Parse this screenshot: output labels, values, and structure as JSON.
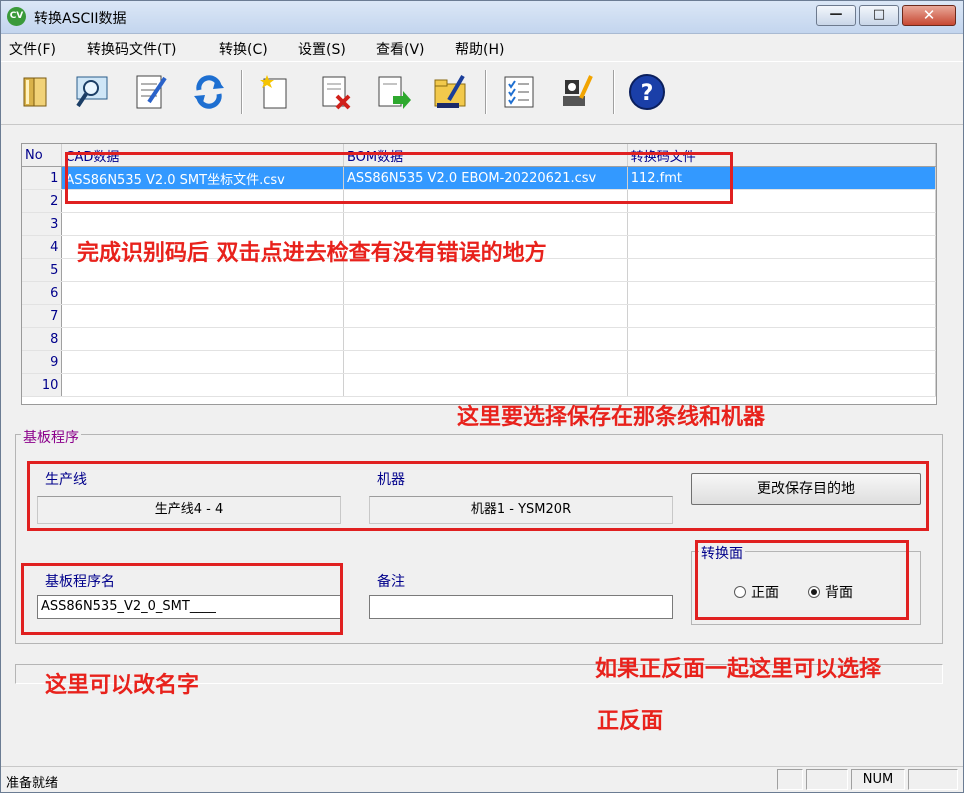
{
  "window": {
    "title": "转换ASCII数据",
    "app_icon": "CV",
    "min_glyph": "—",
    "max_glyph": "□",
    "close_glyph": "✕"
  },
  "menu": [
    "文件(F)",
    "转换码文件(T)",
    "转换(C)",
    "设置(S)",
    "查看(V)",
    "帮助(H)"
  ],
  "toolbar": [
    {
      "icon": "open-book-icon"
    },
    {
      "icon": "magnifier-screen-icon"
    },
    {
      "icon": "edit-notepad-icon"
    },
    {
      "icon": "refresh-arrows-icon"
    },
    {
      "icon": "new-file-icon"
    },
    {
      "icon": "delete-file-icon"
    },
    {
      "icon": "export-file-icon"
    },
    {
      "icon": "folder-pencil-icon"
    },
    {
      "icon": "checklist-icon"
    },
    {
      "icon": "tools-wizard-icon"
    },
    {
      "icon": "help-icon"
    }
  ],
  "grid": {
    "headers": [
      "No",
      "CAD数据",
      "BOM数据",
      "转换码文件"
    ],
    "rows": [
      {
        "no": "1",
        "cad": "ASS86N535 V2.0 SMT坐标文件.csv",
        "bom": "ASS86N535 V2.0 EBOM-20220621.csv",
        "fmt": "112.fmt"
      },
      {
        "no": "2",
        "cad": "",
        "bom": "",
        "fmt": ""
      },
      {
        "no": "3",
        "cad": "",
        "bom": "",
        "fmt": ""
      },
      {
        "no": "4",
        "cad": "",
        "bom": "",
        "fmt": ""
      },
      {
        "no": "5",
        "cad": "",
        "bom": "",
        "fmt": ""
      },
      {
        "no": "6",
        "cad": "",
        "bom": "",
        "fmt": ""
      },
      {
        "no": "7",
        "cad": "",
        "bom": "",
        "fmt": ""
      },
      {
        "no": "8",
        "cad": "",
        "bom": "",
        "fmt": ""
      },
      {
        "no": "9",
        "cad": "",
        "bom": "",
        "fmt": ""
      },
      {
        "no": "10",
        "cad": "",
        "bom": "",
        "fmt": ""
      }
    ]
  },
  "board": {
    "group_title": "基板程序",
    "line_label": "生产线",
    "line_value": "生产线4 - 4",
    "machine_label": "机器",
    "machine_value": "机器1 - YSM20R",
    "change_dest_button": "更改保存目的地",
    "program_label": "基板程序名",
    "program_value": "ASS86N535_V2_0_SMT____",
    "remark_label": "备注",
    "remark_value": "",
    "side_title": "转换面",
    "side_front": "正面",
    "side_back": "背面",
    "side_selected": "背面"
  },
  "status": {
    "text": "准备就绪",
    "num": "NUM"
  },
  "annotations": {
    "note_grid": "完成识别码后 双击点进去检查有没有错误的地方",
    "note_line": "这里要选择保存在那条线和机器",
    "note_name": "这里可以改名字",
    "note_side_1": "如果正反面一起这里可以选择",
    "note_side_2": "正反面",
    "color": "#e8221c"
  }
}
